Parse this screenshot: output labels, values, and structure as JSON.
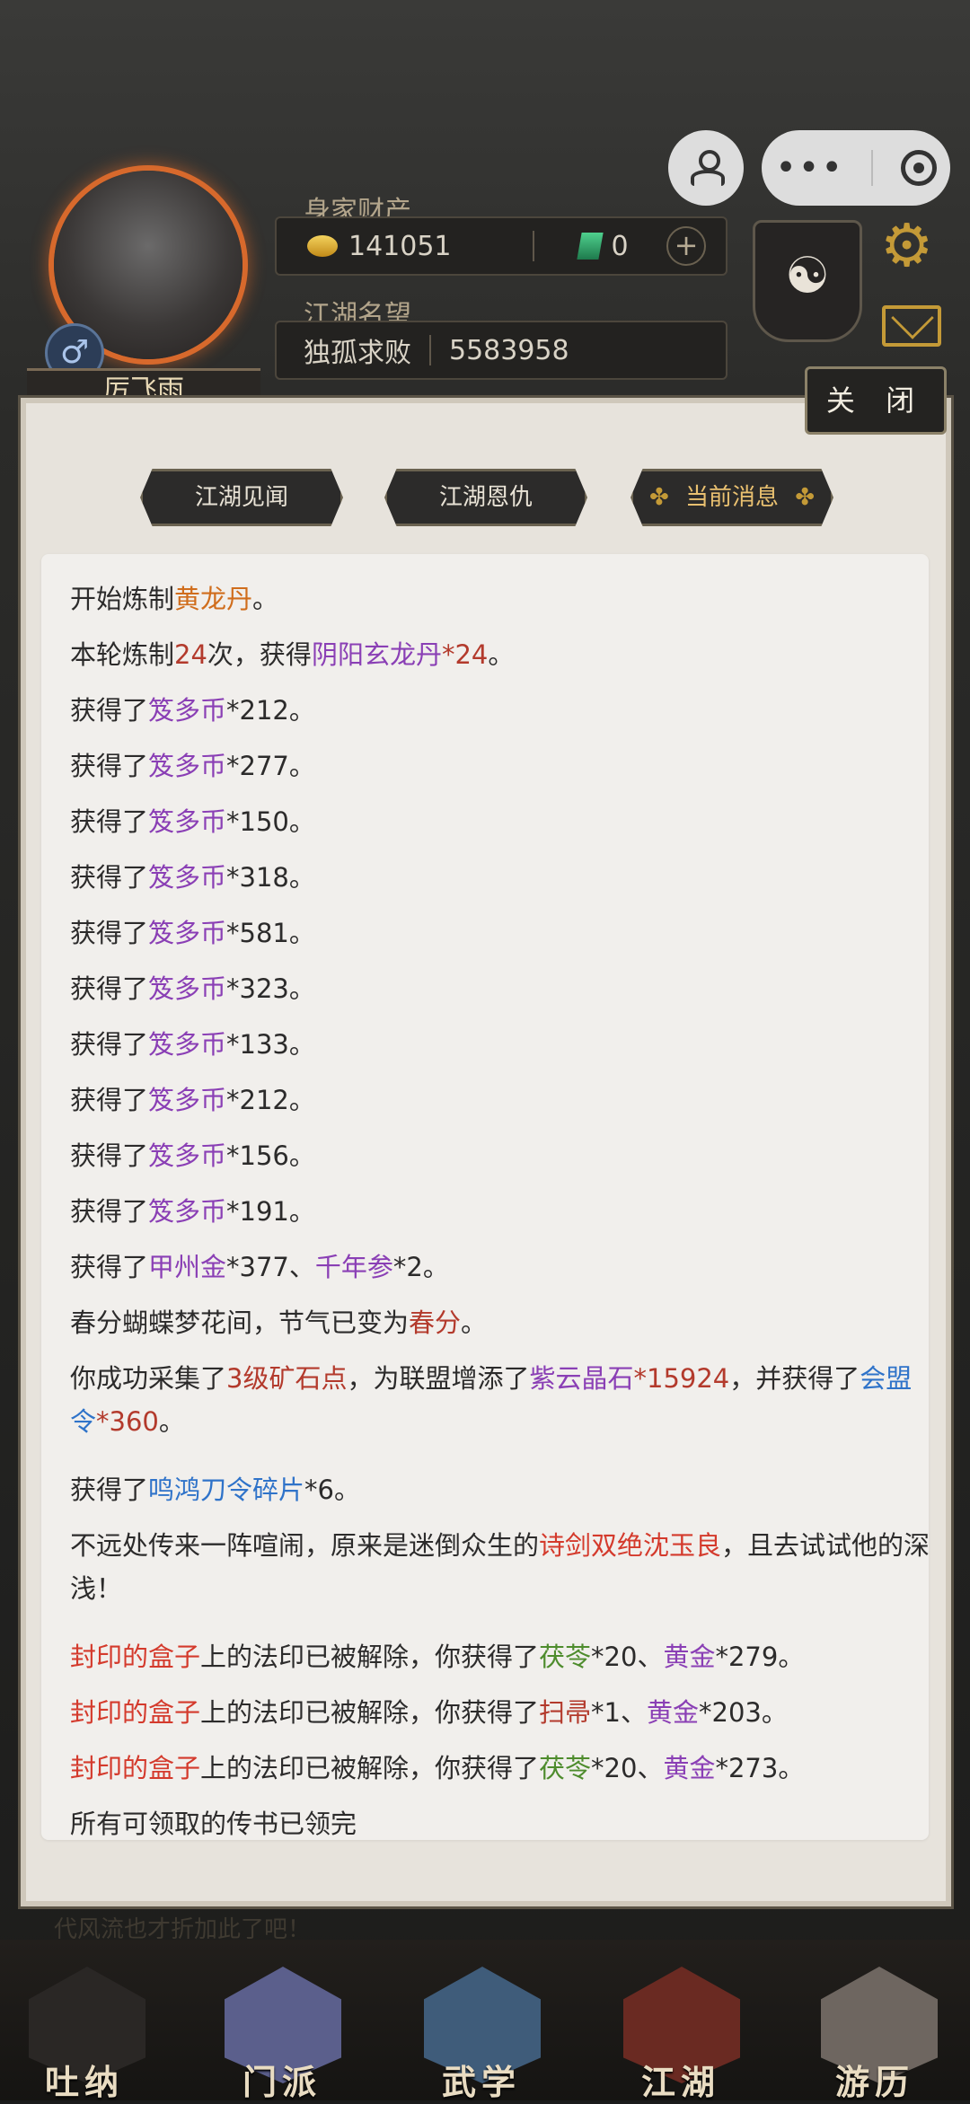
{
  "header": {
    "wealth_label": "身家财产",
    "gold": "141051",
    "jade": "0",
    "reputation_label": "江湖名望",
    "rank_title": "独孤求败",
    "reputation": "5583958",
    "player_name": "厉飞雨",
    "gender_symbol": "♂"
  },
  "modal": {
    "close_label": "关 闭",
    "tabs": [
      "江湖见闻",
      "江湖恩仇",
      "当前消息"
    ]
  },
  "messages": {
    "m1": {
      "a": "开始炼制",
      "item": "黄龙丹",
      "end": "。"
    },
    "m2": {
      "a": "本轮炼制",
      "count": "24",
      "b": "次，获得",
      "item": "阴阳玄龙丹",
      "c": "*",
      "qty": "24",
      "end": "。"
    },
    "coins": [
      {
        "a": "获得了",
        "item": "笈多币",
        "qty": "*212。"
      },
      {
        "a": "获得了",
        "item": "笈多币",
        "qty": "*277。"
      },
      {
        "a": "获得了",
        "item": "笈多币",
        "qty": "*150。"
      },
      {
        "a": "获得了",
        "item": "笈多币",
        "qty": "*318。"
      },
      {
        "a": "获得了",
        "item": "笈多币",
        "qty": "*581。"
      },
      {
        "a": "获得了",
        "item": "笈多币",
        "qty": "*323。"
      },
      {
        "a": "获得了",
        "item": "笈多币",
        "qty": "*133。"
      },
      {
        "a": "获得了",
        "item": "笈多币",
        "qty": "*212。"
      },
      {
        "a": "获得了",
        "item": "笈多币",
        "qty": "*156。"
      },
      {
        "a": "获得了",
        "item": "笈多币",
        "qty": "*191。"
      }
    ],
    "m13": {
      "a": "获得了",
      "item1": "甲州金",
      "q1": "*377、",
      "item2": "千年参",
      "q2": "*2。"
    },
    "m14": {
      "a": "春分蝴蝶梦花间，节气已变为",
      "term": "春分",
      "end": "。"
    },
    "m15": {
      "a": "你成功采集了",
      "mine": "3级矿石点",
      "b": "，为联盟增添了",
      "item": "紫云晶石",
      "c": "*",
      "qty": "15924",
      "d": "，并获得了",
      "token": "会盟令",
      "e": "*",
      "qty2": "360",
      "end": "。"
    },
    "m16": {
      "a": "获得了",
      "item": "鸣鸿刀令碎片",
      "qty": "*6。"
    },
    "m17": {
      "a": "不远处传来一阵喧闹，原来是迷倒众生的",
      "npc": "诗剑双绝沈玉良",
      "b": "，且去试试他的深浅！"
    },
    "boxes": [
      {
        "box": "封印的盒子",
        "a": "上的法印已被解除，你获得了",
        "item1": "茯苓",
        "q1": "*20、",
        "item2": "黄金",
        "q2": "*279。"
      },
      {
        "box": "封印的盒子",
        "a": "上的法印已被解除，你获得了",
        "item1": "扫帚",
        "q1": "*1、",
        "item2": "黄金",
        "q2": "*203。"
      },
      {
        "box": "封印的盒子",
        "a": "上的法印已被解除，你获得了",
        "item1": "茯苓",
        "q1": "*20、",
        "item2": "黄金",
        "q2": "*273。"
      }
    ],
    "last": "所有可领取的传书已领完"
  },
  "bottom_scroll_text": "代风流也才折加此了吧！",
  "nav": [
    "吐纳",
    "门派",
    "武学",
    "江湖",
    "游历"
  ]
}
